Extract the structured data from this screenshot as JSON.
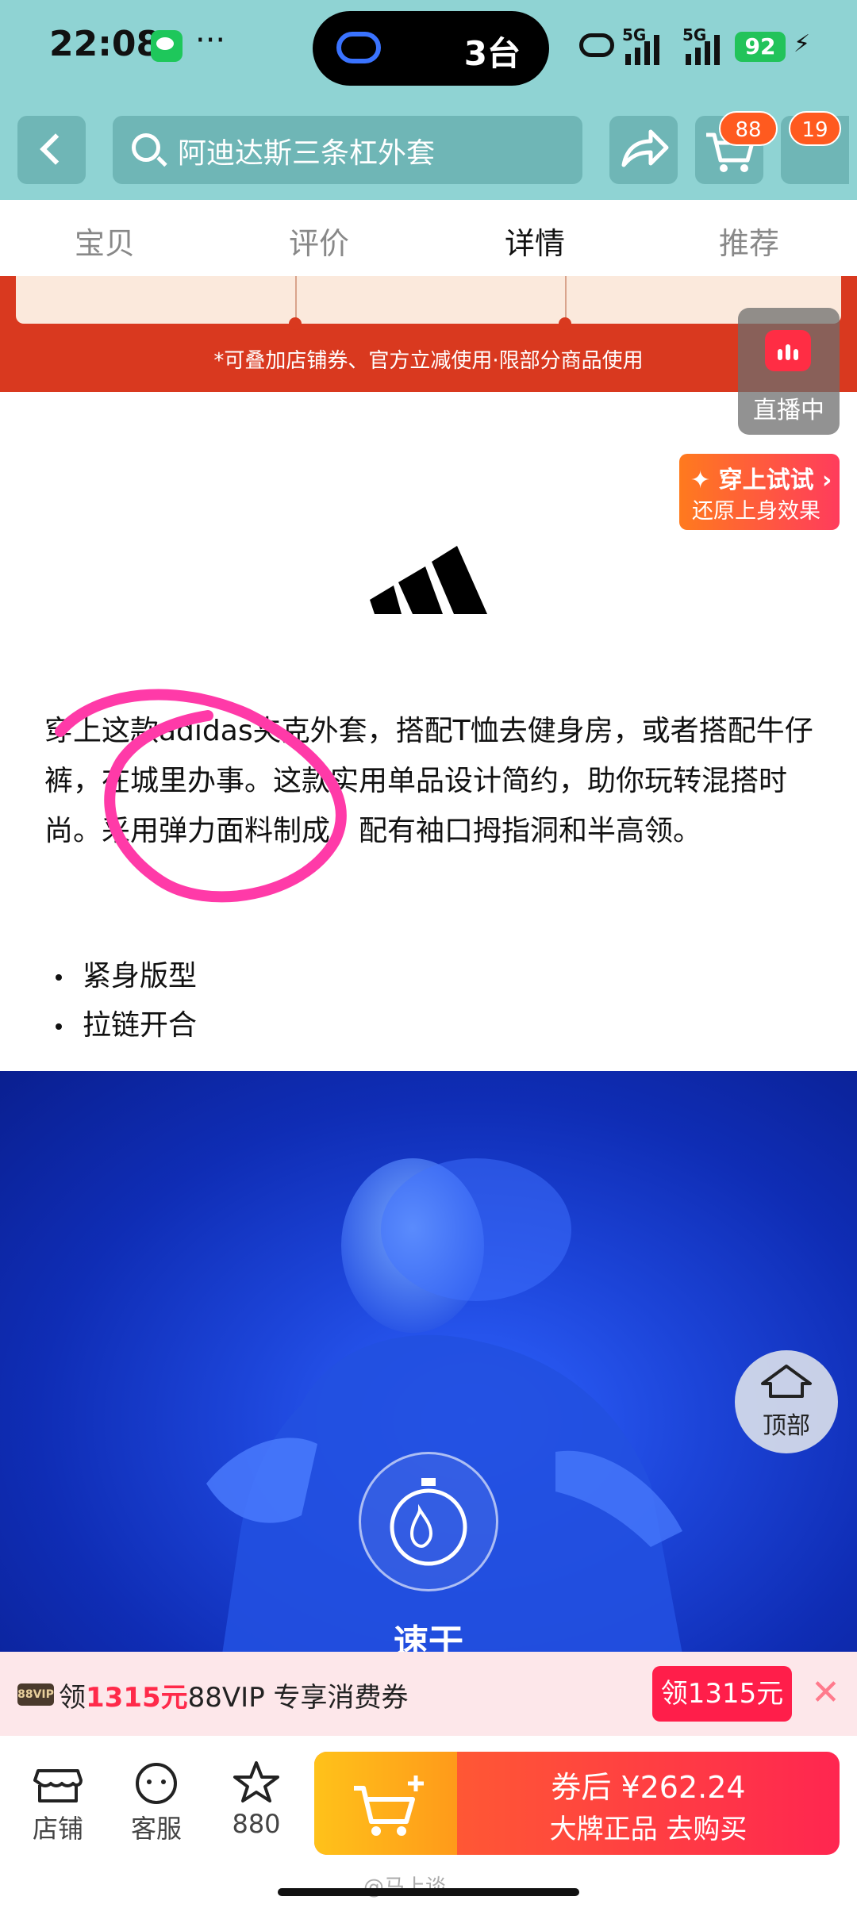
{
  "status_bar": {
    "time": "22:08",
    "more": "···",
    "island_text": "3台",
    "net1": "5G",
    "net2": "5G",
    "battery": "92"
  },
  "header": {
    "search_text": "阿迪达斯三条杠外套",
    "cart_badge": "88",
    "msg_badge": "19"
  },
  "tabs": [
    "宝贝",
    "评价",
    "详情",
    "推荐"
  ],
  "active_tab": "详情",
  "coupon_note": "*可叠加店铺券、官方立减使用·限部分商品使用",
  "live_label": "直播中",
  "tryon": {
    "title": "✦ 穿上试试 ›",
    "subtitle": "还原上身效果"
  },
  "description": "穿上这款adidas夹克外套，搭配T恤去健身房，或者搭配牛仔裤，在城里办事。这款实用单品设计简约，助你玩转混搭时尚。采用弹力面料制成，配有袖口拇指洞和半高领。",
  "bullets": [
    "紧身版型",
    "拉链开合"
  ],
  "hero": {
    "caption": "速干"
  },
  "top_button": "顶部",
  "vip": {
    "tag": "88VIP",
    "prefix": "领",
    "amount": "1315元",
    "suffix": "88VIP 专享消费券",
    "button": "领1315元",
    "close": "✕"
  },
  "bottom_bar": {
    "shop": "店铺",
    "service": "客服",
    "favorites": "880",
    "price_line": "券后 ¥262.24",
    "sub_line": "大牌正品 去购买"
  },
  "watermark": "@马上谈",
  "colors": {
    "header_bg": "#8fd3d3",
    "accent": "#ff2650",
    "hero_blue": "#1c44d8"
  }
}
